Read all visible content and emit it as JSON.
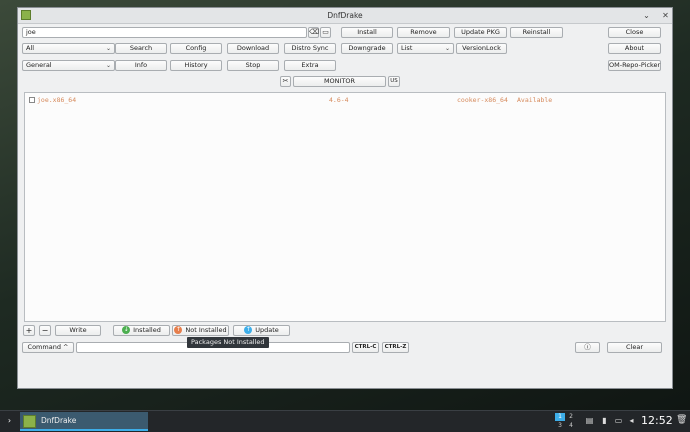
{
  "window": {
    "title": "DnfDrake"
  },
  "search": {
    "value": "joe"
  },
  "toolbar": {
    "row1": {
      "install": "Install",
      "remove": "Remove",
      "update_pkg": "Update PKG",
      "reinstall": "Reinstall",
      "close": "Close"
    },
    "row2": {
      "scope_combo": "All",
      "search": "Search",
      "config": "Config",
      "download": "Download",
      "distro_sync": "Distro Sync",
      "downgrade": "Downgrade",
      "list_combo": "List",
      "versionlock": "VersionLock",
      "about": "About"
    },
    "row3": {
      "category_combo": "General",
      "info": "Info",
      "history": "History",
      "stop": "Stop",
      "extra": "Extra",
      "om_repo_picker": "OM-Repo-Picker"
    },
    "monitor": {
      "label": "MONITOR",
      "lang": "US"
    }
  },
  "packages": [
    {
      "name": "joe.x86_64",
      "version": "4.6-4",
      "repo": "cooker-x86_64",
      "status": "Available"
    }
  ],
  "bottom": {
    "plus": "+",
    "minus": "−",
    "write": "Write",
    "installed": "Installed",
    "not_installed": "Not Installed",
    "update": "Update",
    "tooltip": "Packages Not Installed",
    "command": "Command ^",
    "command_value": "",
    "ctrl_c": "CTRL-C",
    "ctrl_z": "CTRL-Z",
    "clear": "Clear"
  },
  "taskbar": {
    "task_label": "DnfDrake",
    "pager": [
      "1",
      "2",
      "3",
      "4"
    ],
    "clock": "12:52"
  },
  "colors": {
    "installed": "#4caf50",
    "not_installed": "#e67e4c",
    "update": "#3daee9",
    "package_text": "#d68a5c"
  }
}
